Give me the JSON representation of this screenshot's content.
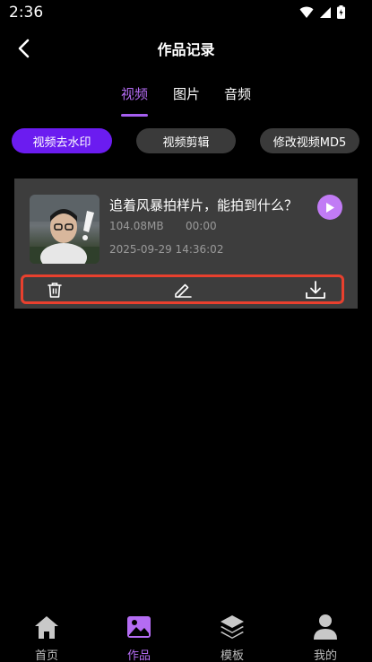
{
  "status_bar": {
    "time": "2:36"
  },
  "header": {
    "title": "作品记录"
  },
  "tabs": [
    {
      "label": "视频",
      "active": true
    },
    {
      "label": "图片",
      "active": false
    },
    {
      "label": "音频",
      "active": false
    }
  ],
  "filters": [
    {
      "label": "视频去水印",
      "active": true
    },
    {
      "label": "视频剪辑",
      "active": false
    },
    {
      "label": "修改视频MD5",
      "active": false
    }
  ],
  "video_item": {
    "title": "追着风暴拍样片，能拍到什么？",
    "size": "104.08MB",
    "duration": "00:00",
    "created_at": "2025-09-29 14:36:02"
  },
  "bottom_nav": [
    {
      "label": "首页",
      "icon": "home-icon",
      "active": false
    },
    {
      "label": "作品",
      "icon": "image-icon",
      "active": true
    },
    {
      "label": "模板",
      "icon": "layers-icon",
      "active": false
    },
    {
      "label": "我的",
      "icon": "user-icon",
      "active": false
    }
  ],
  "colors": {
    "accent": "#b46cf3",
    "pill_active": "#6b1cf0",
    "card_bg": "#3d3d3d",
    "highlight_border": "#e8402e"
  }
}
